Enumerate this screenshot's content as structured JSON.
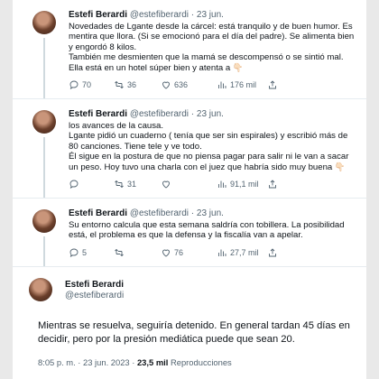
{
  "tweets": [
    {
      "name": "Estefi Berardi",
      "handle": "@estefiberardi",
      "date": "23 jun.",
      "lines": [
        "Novedades de Lgante desde la cárcel: está tranquilo y de buen humor. Es mentira que llora. (Si se emocionó para el día del padre). Se alimenta bien y engordó 8 kilos.",
        "También me desmienten que la mamá se descompensó o se sintió mal.",
        "Ella está en un hotel súper bien y atenta a 👇🏻"
      ],
      "replies": "70",
      "retweets": "36",
      "likes": "636",
      "views": "176 mil"
    },
    {
      "name": "Estefi Berardi",
      "handle": "@estefiberardi",
      "date": "23 jun.",
      "lines": [
        "los avances de la causa.",
        "Lgante pidió un cuaderno ( tenía que ser sin espirales) y escribió más de 80 canciones. Tiene tele y ve todo.",
        "Él sigue en la postura de que no piensa pagar para salir ni le van a sacar un peso. Hoy tuvo una charla con el juez que habría sido muy buena 👇🏻"
      ],
      "replies": "",
      "retweets": "31",
      "likes": "",
      "views": "91,1 mil"
    },
    {
      "name": "Estefi Berardi",
      "handle": "@estefiberardi",
      "date": "23 jun.",
      "lines": [
        "Su entorno calcula que esta semana saldría con tobillera. La posibilidad está, el problema es que la defensa y la fiscalía van a apelar."
      ],
      "replies": "5",
      "retweets": "",
      "likes": "76",
      "views": "27,7 mil"
    }
  ],
  "main": {
    "name": "Estefi Berardi",
    "handle": "@estefiberardi",
    "text": "Mientras se resuelva, seguiría detenido. En general tardan 45 días en decidir, pero por la presión mediática puede que sean 20.",
    "time": "8:05 p. m. · 23 jun. 2023 ·",
    "views_count": "23,5 mil",
    "views_label": "Reproducciones"
  }
}
